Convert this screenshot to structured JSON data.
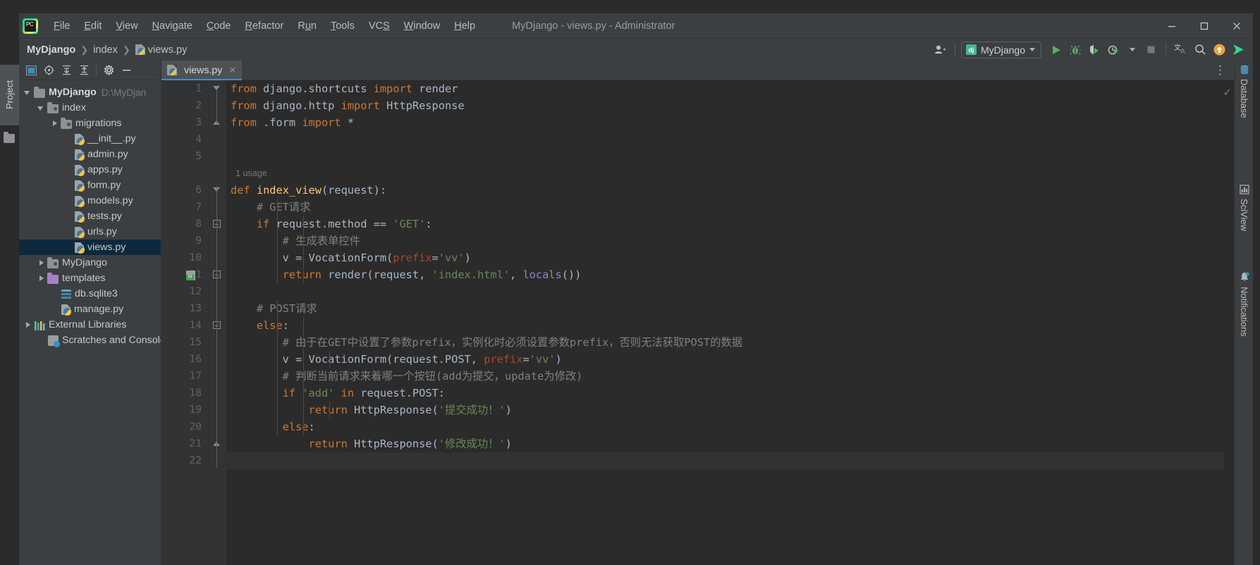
{
  "window": {
    "title": "MyDjango - views.py - Administrator",
    "logo_text": "PC",
    "minimize": "minimize-icon",
    "maximize": "maximize-icon",
    "close": "close-icon"
  },
  "menu": [
    {
      "label": "File",
      "mnemonic": "F"
    },
    {
      "label": "Edit",
      "mnemonic": "E"
    },
    {
      "label": "View",
      "mnemonic": "V"
    },
    {
      "label": "Navigate",
      "mnemonic": "N"
    },
    {
      "label": "Code",
      "mnemonic": "C"
    },
    {
      "label": "Refactor",
      "mnemonic": "R"
    },
    {
      "label": "Run",
      "mnemonic": "u"
    },
    {
      "label": "Tools",
      "mnemonic": "T"
    },
    {
      "label": "VCS",
      "mnemonic": "S"
    },
    {
      "label": "Window",
      "mnemonic": "W"
    },
    {
      "label": "Help",
      "mnemonic": "H"
    }
  ],
  "breadcrumbs": [
    {
      "label": "MyDjango",
      "bold": true,
      "icon": ""
    },
    {
      "label": "index",
      "bold": false,
      "icon": ""
    },
    {
      "label": "views.py",
      "bold": false,
      "icon": "python-file-icon"
    }
  ],
  "toolbar": {
    "account_icon": "user-account-icon",
    "run_config": {
      "icon": "django-icon",
      "icon_text": "dj",
      "name": "MyDjango"
    },
    "run_icon": "run-icon",
    "debug_icon": "debug-icon",
    "run_coverage_icon": "run-with-coverage-icon",
    "profile_icon": "profile-icon",
    "stop_icon": "stop-icon",
    "translate_icon": "translate-icon",
    "search_icon": "search-icon",
    "update_icon": "update-icon",
    "plugin_icon": "ide-services-icon"
  },
  "left_tool_window": {
    "tab_label": "Project",
    "toolbar_icons": [
      "project-view-icon",
      "locate-icon",
      "expand-all-icon",
      "collapse-all-icon",
      "settings-gear-icon",
      "hide-icon"
    ]
  },
  "project_tree": [
    {
      "label": "MyDjango",
      "path": "D:\\MyDjan",
      "icon": "folder-icon",
      "arrow": "open",
      "depth": 0,
      "bold": true,
      "selected": false
    },
    {
      "label": "index",
      "path": "",
      "icon": "module-icon",
      "arrow": "open",
      "depth": 1,
      "bold": false,
      "selected": false
    },
    {
      "label": "migrations",
      "path": "",
      "icon": "module-icon",
      "arrow": "closed",
      "depth": 2,
      "bold": false,
      "selected": false
    },
    {
      "label": "__init__.py",
      "path": "",
      "icon": "python-file-icon",
      "arrow": "none",
      "depth": 3,
      "bold": false,
      "selected": false
    },
    {
      "label": "admin.py",
      "path": "",
      "icon": "python-file-icon",
      "arrow": "none",
      "depth": 3,
      "bold": false,
      "selected": false
    },
    {
      "label": "apps.py",
      "path": "",
      "icon": "python-file-icon",
      "arrow": "none",
      "depth": 3,
      "bold": false,
      "selected": false
    },
    {
      "label": "form.py",
      "path": "",
      "icon": "python-file-icon",
      "arrow": "none",
      "depth": 3,
      "bold": false,
      "selected": false
    },
    {
      "label": "models.py",
      "path": "",
      "icon": "python-file-icon",
      "arrow": "none",
      "depth": 3,
      "bold": false,
      "selected": false
    },
    {
      "label": "tests.py",
      "path": "",
      "icon": "python-file-icon",
      "arrow": "none",
      "depth": 3,
      "bold": false,
      "selected": false
    },
    {
      "label": "urls.py",
      "path": "",
      "icon": "python-file-icon",
      "arrow": "none",
      "depth": 3,
      "bold": false,
      "selected": false
    },
    {
      "label": "views.py",
      "path": "",
      "icon": "python-file-icon",
      "arrow": "none",
      "depth": 3,
      "bold": false,
      "selected": true
    },
    {
      "label": "MyDjango",
      "path": "",
      "icon": "module-icon",
      "arrow": "closed",
      "depth": 1,
      "bold": false,
      "selected": false
    },
    {
      "label": "templates",
      "path": "",
      "icon": "folder-purple-icon",
      "arrow": "closed",
      "depth": 1,
      "bold": false,
      "selected": false
    },
    {
      "label": "db.sqlite3",
      "path": "",
      "icon": "database-file-icon",
      "arrow": "none",
      "depth": 2,
      "bold": false,
      "selected": false
    },
    {
      "label": "manage.py",
      "path": "",
      "icon": "python-file-icon",
      "arrow": "none",
      "depth": 2,
      "bold": false,
      "selected": false
    },
    {
      "label": "External Libraries",
      "path": "",
      "icon": "external-libraries-icon",
      "arrow": "closed",
      "depth": 0,
      "bold": false,
      "selected": false
    },
    {
      "label": "Scratches and Console",
      "path": "",
      "icon": "scratches-icon",
      "arrow": "none",
      "depth": 1,
      "bold": false,
      "selected": false
    }
  ],
  "editor": {
    "tabs": [
      {
        "label": "views.py",
        "icon": "python-file-icon",
        "close": "×",
        "active": true
      }
    ],
    "options_icon": "more-options-icon",
    "inspection_ok": "✓",
    "total_lines": 22,
    "lines": [
      {
        "n": 1,
        "fold": "tri-down",
        "inlay": "",
        "gutter_icon": "",
        "tokens": [
          {
            "t": "from",
            "c": "kw"
          },
          {
            "t": " django.shortcuts ",
            "c": "id"
          },
          {
            "t": "import",
            "c": "kw"
          },
          {
            "t": " render",
            "c": "id"
          }
        ]
      },
      {
        "n": 2,
        "fold": "",
        "inlay": "",
        "gutter_icon": "",
        "tokens": [
          {
            "t": "from",
            "c": "kw"
          },
          {
            "t": " django.http ",
            "c": "id"
          },
          {
            "t": "import",
            "c": "kw"
          },
          {
            "t": " HttpResponse",
            "c": "id"
          }
        ]
      },
      {
        "n": 3,
        "fold": "tri-up",
        "inlay": "",
        "gutter_icon": "",
        "tokens": [
          {
            "t": "from",
            "c": "kw"
          },
          {
            "t": " .form ",
            "c": "id"
          },
          {
            "t": "import",
            "c": "kw"
          },
          {
            "t": " *",
            "c": "id"
          }
        ]
      },
      {
        "n": 4,
        "fold": "",
        "inlay": "",
        "gutter_icon": "",
        "tokens": []
      },
      {
        "n": 5,
        "fold": "",
        "inlay": "",
        "gutter_icon": "",
        "tokens": []
      },
      {
        "n": 6,
        "fold": "tri-down",
        "inlay": "1 usage",
        "gutter_icon": "",
        "tokens": [
          {
            "t": "def",
            "c": "kw"
          },
          {
            "t": " ",
            "c": "id"
          },
          {
            "t": "index_view",
            "c": "fn"
          },
          {
            "t": "(request):",
            "c": "id"
          }
        ]
      },
      {
        "n": 7,
        "fold": "",
        "inlay": "",
        "gutter_icon": "",
        "tokens": [
          {
            "t": "    # GET请求",
            "c": "cm"
          }
        ]
      },
      {
        "n": 8,
        "fold": "box",
        "inlay": "",
        "gutter_icon": "",
        "tokens": [
          {
            "t": "    ",
            "c": "id"
          },
          {
            "t": "if",
            "c": "kw"
          },
          {
            "t": " request.method == ",
            "c": "id"
          },
          {
            "t": "'GET'",
            "c": "str"
          },
          {
            "t": ":",
            "c": "id"
          }
        ]
      },
      {
        "n": 9,
        "fold": "",
        "inlay": "",
        "gutter_icon": "",
        "tokens": [
          {
            "t": "        # 生成表单控件",
            "c": "cm"
          }
        ]
      },
      {
        "n": 10,
        "fold": "",
        "inlay": "",
        "gutter_icon": "",
        "tokens": [
          {
            "t": "        v = VocationForm(",
            "c": "id"
          },
          {
            "t": "prefix",
            "c": "kwarg"
          },
          {
            "t": "=",
            "c": "id"
          },
          {
            "t": "'vv'",
            "c": "str"
          },
          {
            "t": ")",
            "c": "id"
          }
        ]
      },
      {
        "n": 11,
        "fold": "box",
        "inlay": "",
        "gutter_icon": "html-file-icon",
        "tokens": [
          {
            "t": "        ",
            "c": "id"
          },
          {
            "t": "return",
            "c": "kw"
          },
          {
            "t": " render(request, ",
            "c": "id"
          },
          {
            "t": "'index.html'",
            "c": "str"
          },
          {
            "t": ", ",
            "c": "id"
          },
          {
            "t": "locals",
            "c": "bi"
          },
          {
            "t": "())",
            "c": "id"
          }
        ]
      },
      {
        "n": 12,
        "fold": "",
        "inlay": "",
        "gutter_icon": "",
        "tokens": []
      },
      {
        "n": 13,
        "fold": "",
        "inlay": "",
        "gutter_icon": "",
        "tokens": [
          {
            "t": "    # POST请求",
            "c": "cm"
          }
        ]
      },
      {
        "n": 14,
        "fold": "box",
        "inlay": "",
        "gutter_icon": "",
        "tokens": [
          {
            "t": "    ",
            "c": "id"
          },
          {
            "t": "else",
            "c": "kw"
          },
          {
            "t": ":",
            "c": "id"
          }
        ]
      },
      {
        "n": 15,
        "fold": "",
        "inlay": "",
        "gutter_icon": "",
        "tokens": [
          {
            "t": "        # 由于在GET中设置了参数prefix，实例化时必须设置参数prefix，否则无法获取POST的数据",
            "c": "cm"
          }
        ]
      },
      {
        "n": 16,
        "fold": "",
        "inlay": "",
        "gutter_icon": "",
        "tokens": [
          {
            "t": "        v = VocationForm(request.POST, ",
            "c": "id"
          },
          {
            "t": "prefix",
            "c": "kwarg"
          },
          {
            "t": "=",
            "c": "id"
          },
          {
            "t": "'vv'",
            "c": "str"
          },
          {
            "t": ")",
            "c": "id"
          }
        ]
      },
      {
        "n": 17,
        "fold": "",
        "inlay": "",
        "gutter_icon": "",
        "tokens": [
          {
            "t": "        # 判断当前请求来着哪一个按钮(add为提交，update为修改)",
            "c": "cm"
          }
        ]
      },
      {
        "n": 18,
        "fold": "",
        "inlay": "",
        "gutter_icon": "",
        "tokens": [
          {
            "t": "        ",
            "c": "id"
          },
          {
            "t": "if",
            "c": "kw"
          },
          {
            "t": " ",
            "c": "id"
          },
          {
            "t": "'add'",
            "c": "str"
          },
          {
            "t": " ",
            "c": "id"
          },
          {
            "t": "in",
            "c": "kw"
          },
          {
            "t": " request.POST:",
            "c": "id"
          }
        ]
      },
      {
        "n": 19,
        "fold": "",
        "inlay": "",
        "gutter_icon": "",
        "tokens": [
          {
            "t": "            ",
            "c": "id"
          },
          {
            "t": "return",
            "c": "kw"
          },
          {
            "t": " HttpResponse(",
            "c": "id"
          },
          {
            "t": "'提交成功！'",
            "c": "str"
          },
          {
            "t": ")",
            "c": "id"
          }
        ]
      },
      {
        "n": 20,
        "fold": "",
        "inlay": "",
        "gutter_icon": "",
        "tokens": [
          {
            "t": "        ",
            "c": "id"
          },
          {
            "t": "else",
            "c": "kw"
          },
          {
            "t": ":",
            "c": "id"
          }
        ]
      },
      {
        "n": 21,
        "fold": "tri-up",
        "inlay": "",
        "gutter_icon": "",
        "tokens": [
          {
            "t": "            ",
            "c": "id"
          },
          {
            "t": "return",
            "c": "kw"
          },
          {
            "t": " HttpResponse(",
            "c": "id"
          },
          {
            "t": "'修改成功！'",
            "c": "str"
          },
          {
            "t": ")",
            "c": "id"
          }
        ]
      },
      {
        "n": 22,
        "fold": "",
        "inlay": "",
        "gutter_icon": "",
        "tokens": []
      }
    ]
  },
  "right_tool_windows": [
    {
      "label": "Database",
      "icon": "database-icon"
    },
    {
      "label": "SciView",
      "icon": "sciview-icon"
    },
    {
      "label": "Notifications",
      "icon": "notifications-icon"
    }
  ],
  "colors": {
    "chrome_bg": "#3c3f41",
    "editor_bg": "#2b2b2b",
    "gutter_bg": "#313335",
    "tab_active_bg": "#4e5254",
    "tab_underline": "#4a88c7",
    "selection_bg": "#0d293f",
    "keyword": "#cc7832",
    "string": "#6a8759",
    "function": "#ffc66d",
    "comment": "#808080",
    "identifier": "#a9b7c6",
    "builtin": "#8888c6",
    "kwarg": "#aa4926",
    "run_green": "#59a869",
    "accent_orange": "#e8a33d"
  }
}
